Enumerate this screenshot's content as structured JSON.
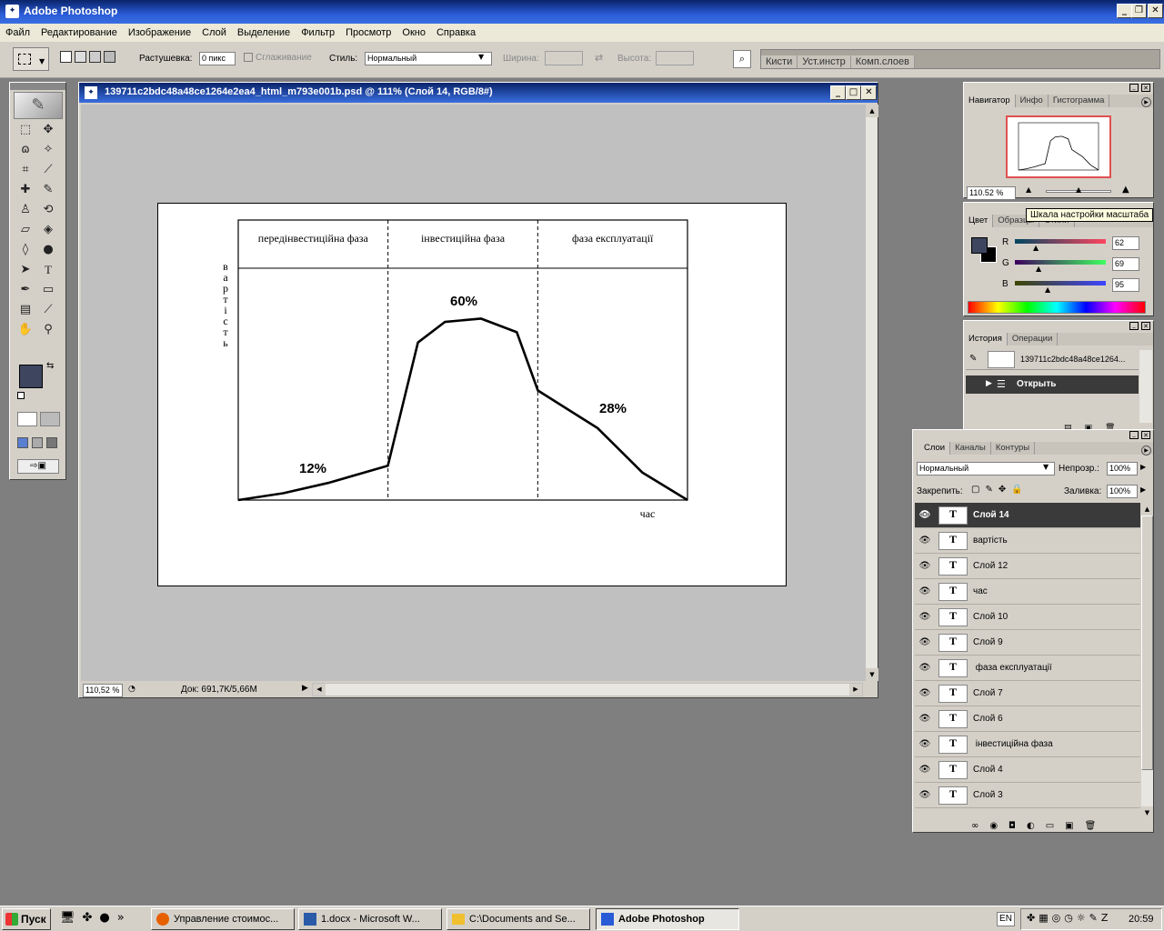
{
  "app": {
    "title": "Adobe Photoshop"
  },
  "menu": [
    "Файл",
    "Редактирование",
    "Изображение",
    "Слой",
    "Выделение",
    "Фильтр",
    "Просмотр",
    "Окно",
    "Справка"
  ],
  "options": {
    "feather_label": "Растушевка:",
    "feather_value": "0 пикс",
    "antialias_label": "Сглаживание",
    "style_label": "Стиль:",
    "style_value": "Нормальный",
    "width_label": "Ширина:",
    "height_label": "Высота:",
    "wells": [
      "Кисти",
      "Уст.инстр",
      "Комп.слоев"
    ]
  },
  "document": {
    "title": "139711c2bdc48a48ce1264e2ea4_html_m793e001b.psd @ 111% (Слой 14, RGB/8#)",
    "zoom": "110,52 %",
    "doc_info": "Док: 691,7К/5,66М"
  },
  "chart_data": {
    "type": "line",
    "x": [
      0,
      10,
      20,
      33.3,
      40,
      46,
      54,
      62,
      66.7,
      80,
      90,
      100
    ],
    "y": [
      0,
      2,
      5,
      10,
      46,
      52,
      53,
      49,
      32,
      21,
      8,
      0
    ],
    "phases": [
      "передінвестиційна фаза",
      "інвестиційна фаза",
      "фаза експлуатації"
    ],
    "annotations": [
      "12%",
      "60%",
      "28%"
    ],
    "ylabel": "вартість",
    "xlabel": "час",
    "xlim": [
      0,
      100
    ],
    "ylim": [
      0,
      60
    ],
    "grid": false
  },
  "navigator": {
    "tabs": [
      "Навигатор",
      "Инфо",
      "Гистограмма"
    ],
    "zoom": "110.52 %",
    "tooltip": "Шкала настройки масштаба"
  },
  "color": {
    "tabs": [
      "Цвет",
      "Образцы",
      "Стили"
    ],
    "r": "62",
    "g": "69",
    "b": "95",
    "r_label": "R",
    "g_label": "G",
    "b_label": "B",
    "foreground": "#3e455f",
    "background": "#000000"
  },
  "history": {
    "tabs": [
      "История",
      "Операции"
    ],
    "snapshot": "139711c2bdc48a48ce1264...",
    "step": "Открыть"
  },
  "layers": {
    "tabs": [
      "Слои",
      "Каналы",
      "Контуры"
    ],
    "blend": "Нормальный",
    "opacity_label": "Непрозр.:",
    "opacity": "100%",
    "lock_label": "Закрепить:",
    "fill_label": "Заливка:",
    "fill": "100%",
    "thumb_glyph": "T",
    "items": [
      "Слой 14",
      "вартість",
      "Слой 12",
      "час",
      "Слой 10",
      "Слой 9",
      " фаза експлуатації",
      "Слой 7",
      "Слой 6",
      " інвестиційна фаза",
      "Слой 4",
      "Слой 3"
    ]
  },
  "taskbar": {
    "start": "Пуск",
    "items": [
      "Управление стоимос...",
      "1.docx - Microsoft W...",
      "C:\\Documents and Se...",
      "Adobe Photoshop"
    ],
    "lang": "EN",
    "clock": "20:59"
  }
}
